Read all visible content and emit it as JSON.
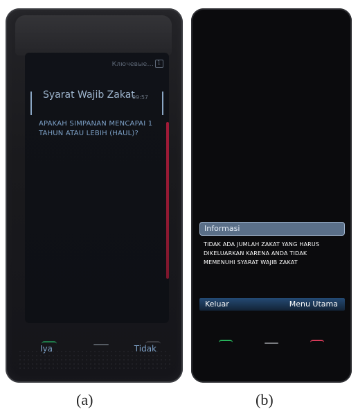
{
  "panel_a": {
    "status_text": "Ключевые...",
    "status_badge": "1",
    "title": "Syarat Wajib Zakat",
    "time": "09:57",
    "question": "APAKAH SIMPANAN MENCAPAI 1 TAHUN ATAU LEBIH (HAUL)?",
    "softkey_left": "Iya",
    "softkey_right": "Tidak",
    "caption": "(a)"
  },
  "panel_b": {
    "dialog_title": "Informasi",
    "dialog_message": "TIDAK ADA JUMLAH ZAKAT YANG HARUS DIKELUARKAN KARENA ANDA TIDAK MEMENUHI SYARAT WAJIB ZAKAT",
    "softkey_left": "Keluar",
    "softkey_right": "Menu Utama",
    "caption": "(b)"
  },
  "colors": {
    "phone_body": "#1b1c20",
    "screen_bg": "#0f1116",
    "text_blue": "#7ea2c8",
    "text_white": "#ffffff",
    "dialog_title_bg": "#5a6f88",
    "softbar_bg": "#1b3352",
    "scroll_red": "#b21b3c",
    "call_green": "#27b25a",
    "end_red": "#d63a58"
  },
  "icons": {
    "signal": "signal-icon",
    "battery": "battery-icon",
    "status_badge": "badge-icon",
    "call": "call-icon",
    "menu": "menu-icon",
    "end_call": "end-call-icon",
    "scrollbar": "scrollbar"
  }
}
